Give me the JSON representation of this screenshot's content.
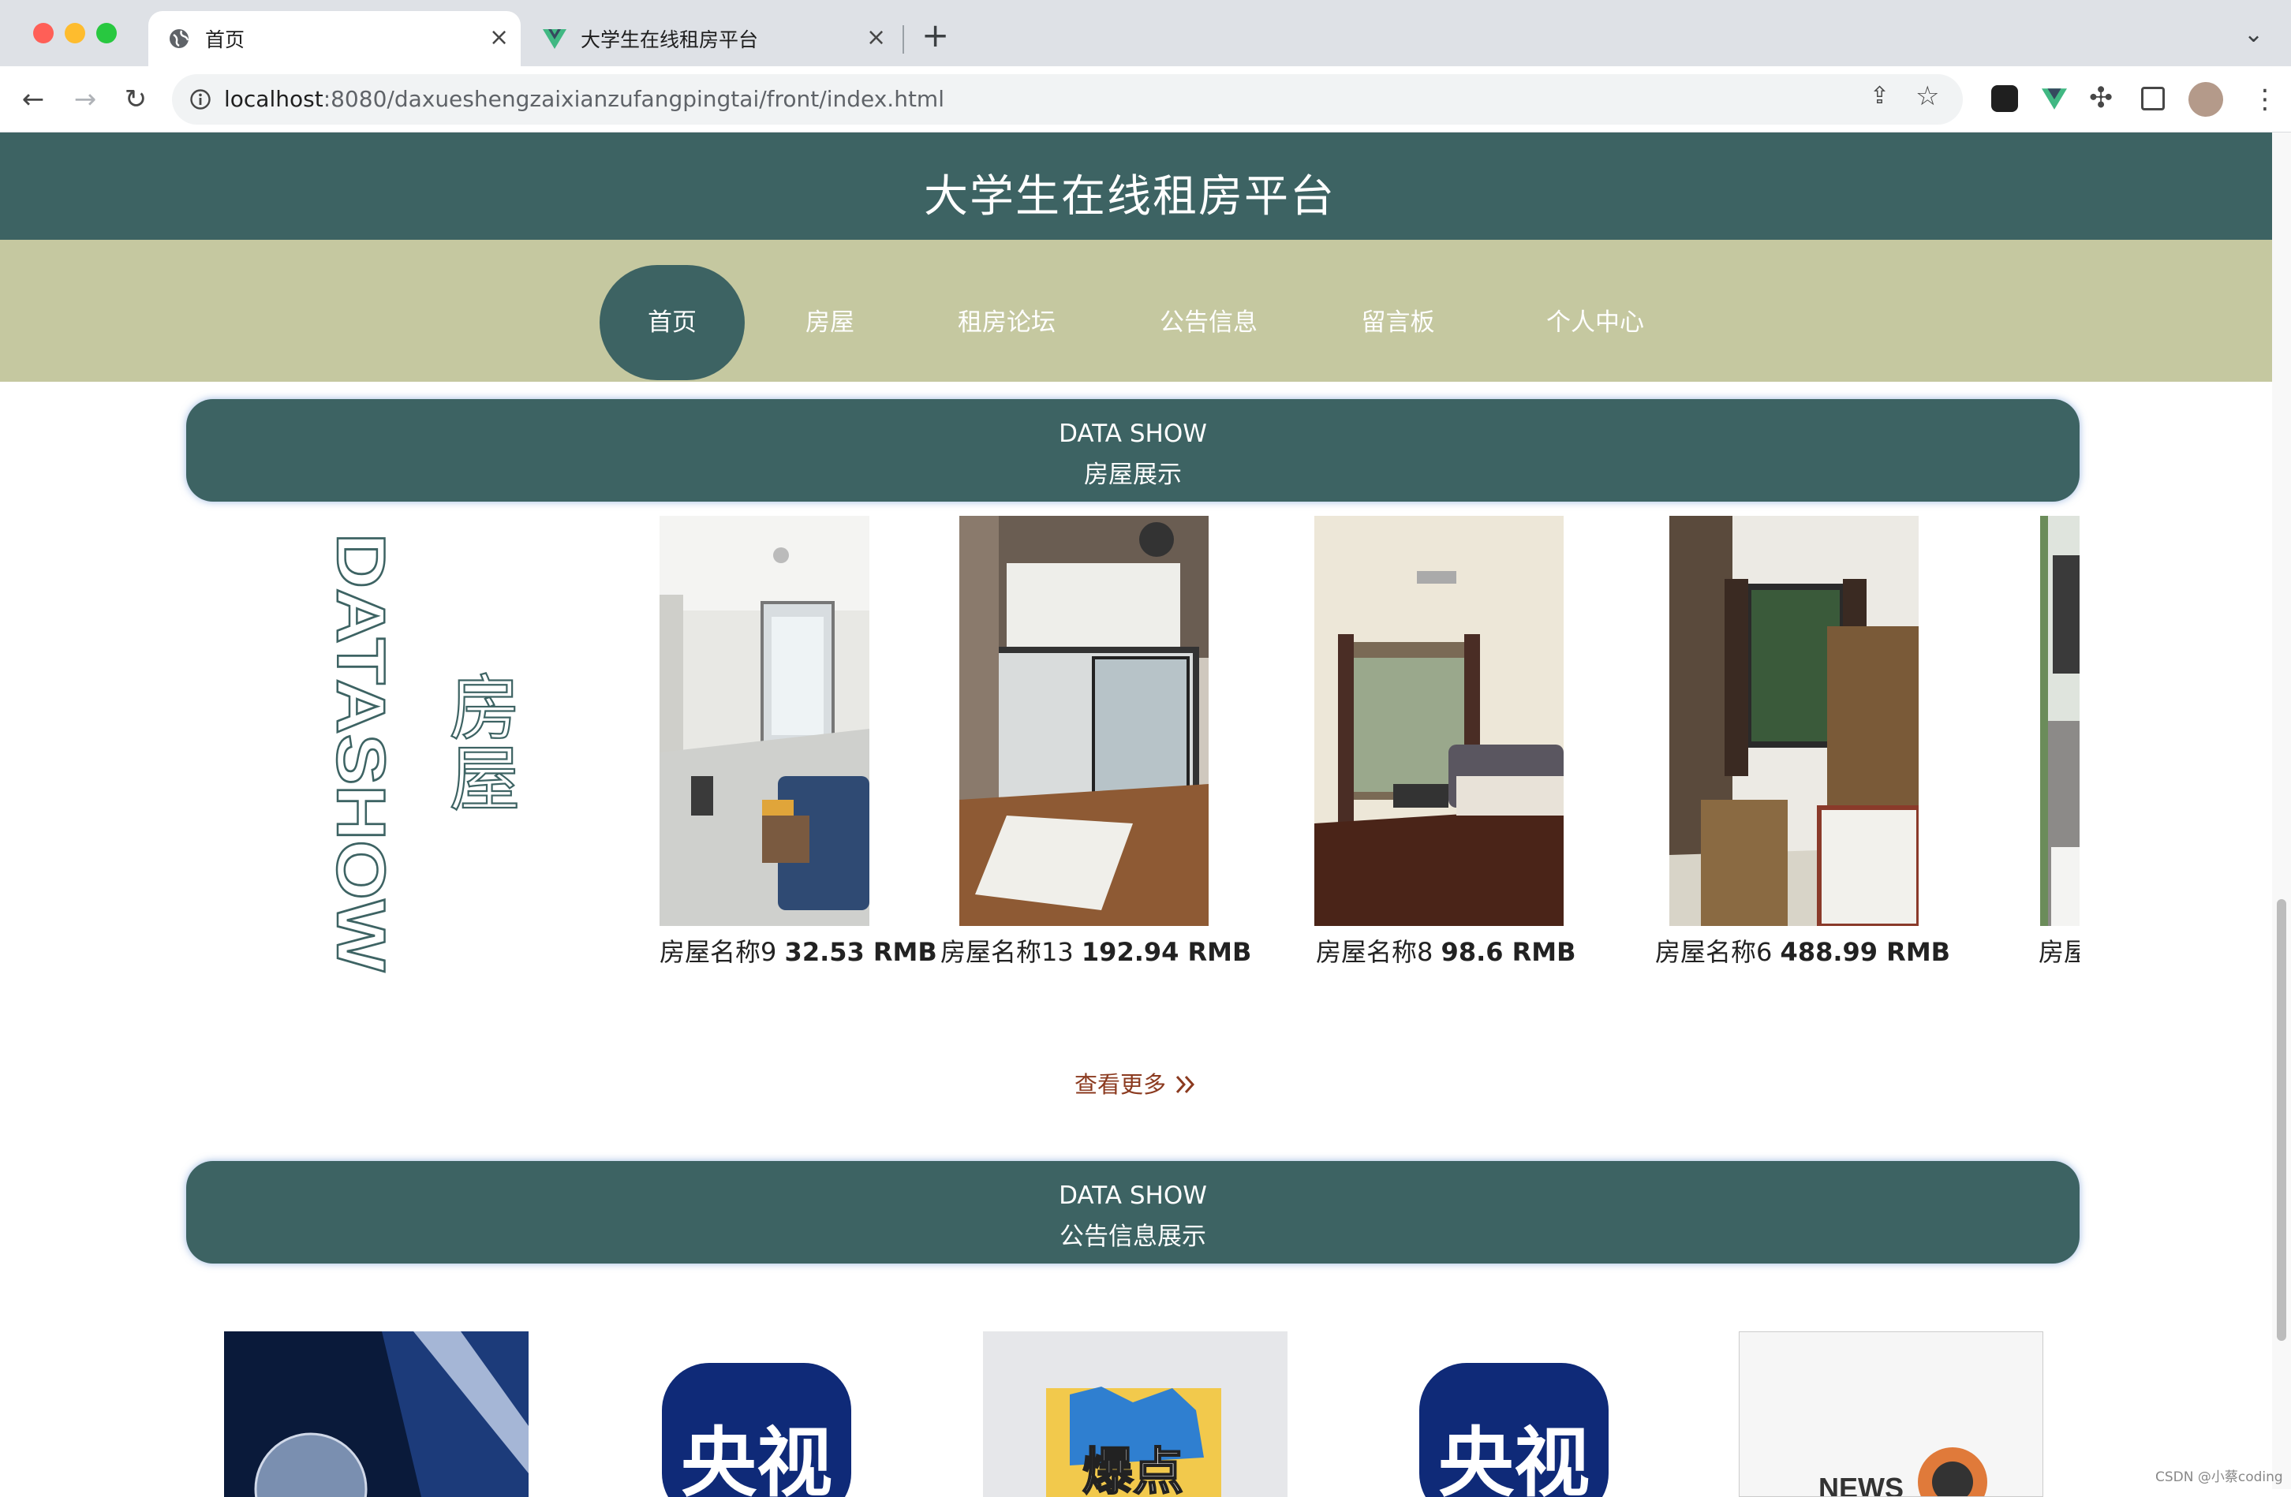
{
  "browser": {
    "tabs": [
      {
        "title": "首页",
        "icon": "globe-icon",
        "active": true
      },
      {
        "title": "大学生在线租房平台",
        "icon": "vue-logo-icon",
        "active": false
      }
    ],
    "new_tab": "+",
    "url_host": "localhost",
    "url_path": ":8080/daxueshengzaixianzufangpingtai/front/index.html"
  },
  "site": {
    "title": "大学生在线租房平台",
    "nav": [
      "首页",
      "房屋",
      "租房论坛",
      "公告信息",
      "留言板",
      "个人中心"
    ],
    "nav_active": "首页"
  },
  "houses_section": {
    "en": "DATA SHOW",
    "zh": "房屋展示",
    "side_en": "DATASHOW",
    "side_zh": "房屋",
    "items": [
      {
        "name": "房屋名称9",
        "price": "32.53 RMB"
      },
      {
        "name": "房屋名称13",
        "price": "192.94 RMB"
      },
      {
        "name": "房屋名称8",
        "price": "98.6 RMB"
      },
      {
        "name": "房屋名称6",
        "price": "488.99 RMB"
      },
      {
        "name": "房屋",
        "price": ""
      }
    ],
    "more": "查看更多",
    "more_icon": "double-chevron-right-icon"
  },
  "notice_section": {
    "en": "DATA SHOW",
    "zh": "公告信息展示",
    "images": [
      "央视",
      "爆点",
      "央视",
      "NEWS"
    ]
  },
  "colors": {
    "primary": "#3d6363",
    "nav_bg": "#c5c8a0",
    "more_link": "#8b3a1f"
  },
  "watermark": "CSDN @小蔡coding"
}
